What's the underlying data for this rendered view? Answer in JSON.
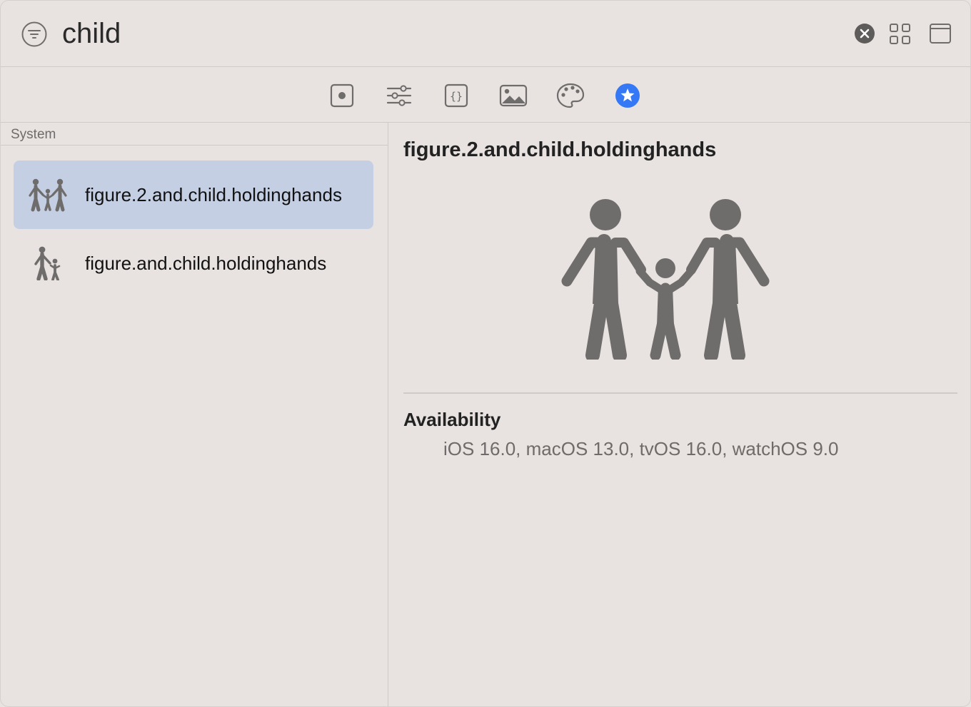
{
  "search": {
    "value": "child",
    "filter_icon": "filter-icon",
    "clear_icon": "clear-search-icon"
  },
  "header_buttons": {
    "grid_icon": "grid-view-icon",
    "window_icon": "window-icon"
  },
  "tabs": [
    {
      "icon": "component-icon",
      "active": false
    },
    {
      "icon": "sliders-icon",
      "active": false
    },
    {
      "icon": "code-braces-icon",
      "active": false
    },
    {
      "icon": "image-icon",
      "active": false
    },
    {
      "icon": "palette-icon",
      "active": false
    },
    {
      "icon": "star-icon",
      "active": true
    }
  ],
  "colors": {
    "accent": "#3478f6",
    "selection": "#c5cfe4",
    "icon": "#6f6d6c"
  },
  "sidebar": {
    "section_label": "System",
    "items": [
      {
        "label": "figure.2.and.child.holdinghands",
        "icon": "family-icon",
        "selected": true
      },
      {
        "label": "figure.and.child.holdinghands",
        "icon": "parent-child-icon",
        "selected": false
      }
    ]
  },
  "detail": {
    "title": "figure.2.and.child.holdinghands",
    "availability_heading": "Availability",
    "availability_value": "iOS 16.0, macOS 13.0, tvOS 16.0, watchOS 9.0"
  }
}
